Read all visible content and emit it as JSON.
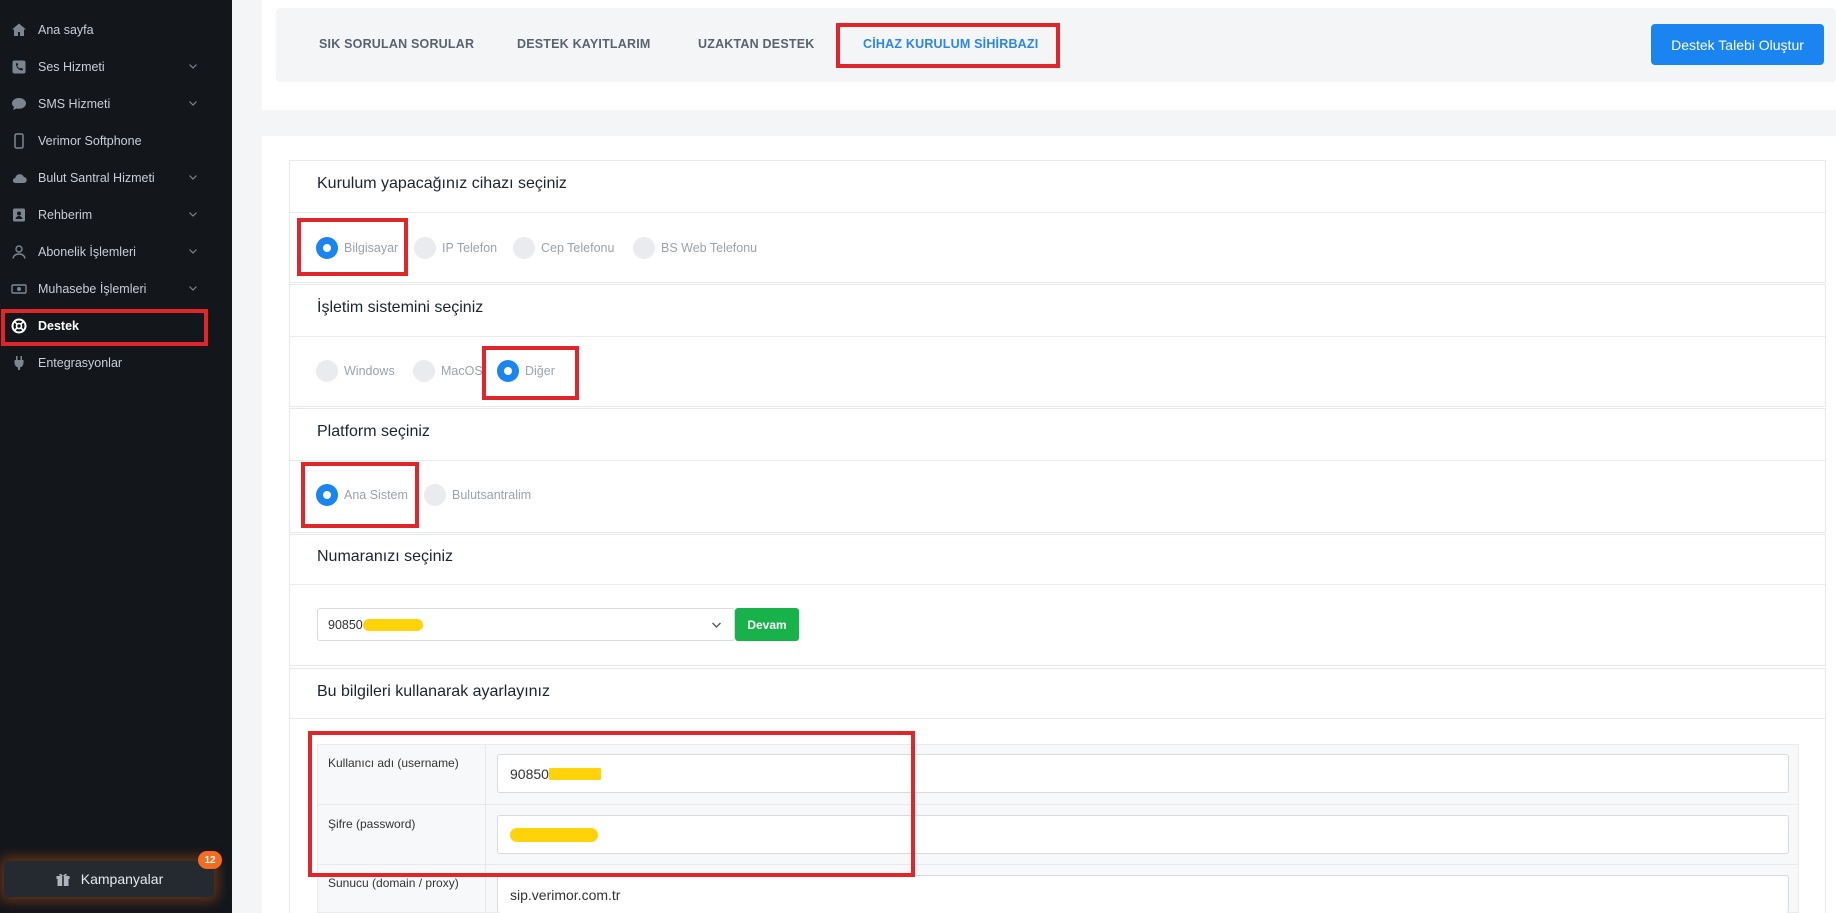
{
  "sidebar": {
    "items": [
      {
        "label": "Ana sayfa",
        "icon": "home-icon",
        "has_chevron": false
      },
      {
        "label": "Ses Hizmeti",
        "icon": "phone-icon",
        "has_chevron": true
      },
      {
        "label": "SMS Hizmeti",
        "icon": "chat-icon",
        "has_chevron": true
      },
      {
        "label": "Verimor Softphone",
        "icon": "mobile-icon",
        "has_chevron": false
      },
      {
        "label": "Bulut Santral Hizmeti",
        "icon": "cloud-icon",
        "has_chevron": true
      },
      {
        "label": "Rehberim",
        "icon": "contacts-icon",
        "has_chevron": true
      },
      {
        "label": "Abonelik İşlemleri",
        "icon": "user-icon",
        "has_chevron": true
      },
      {
        "label": "Muhasebe İşlemleri",
        "icon": "money-icon",
        "has_chevron": true
      },
      {
        "label": "Destek",
        "icon": "lifebuoy-icon",
        "has_chevron": false,
        "active": true
      },
      {
        "label": "Entegrasyonlar",
        "icon": "plug-icon",
        "has_chevron": false
      }
    ],
    "campaigns": {
      "label": "Kampanyalar",
      "badge": "12",
      "icon": "gift-icon"
    }
  },
  "tabs": [
    {
      "label": "SIK SORULAN SORULAR"
    },
    {
      "label": "DESTEK KAYITLARIM"
    },
    {
      "label": "UZAKTAN DESTEK"
    },
    {
      "label": "CİHAZ KURULUM SİHİRBAZI",
      "active": true
    }
  ],
  "cta_label": "Destek Talebi Oluştur",
  "device_section": {
    "title": "Kurulum yapacağınız cihazı seçiniz",
    "options": [
      "Bilgisayar",
      "IP Telefon",
      "Cep Telefonu",
      "BS Web Telefonu"
    ],
    "selected": "Bilgisayar"
  },
  "os_section": {
    "title": "İşletim sistemini seçiniz",
    "options": [
      "Windows",
      "MacOS",
      "Diğer"
    ],
    "selected": "Diğer"
  },
  "platform_section": {
    "title": "Platform seçiniz",
    "options": [
      "Ana Sistem",
      "Bulutsantralim"
    ],
    "selected": "Ana Sistem"
  },
  "number_section": {
    "title": "Numaranızı seçiniz",
    "selected_prefix": "90850",
    "continue_label": "Devam"
  },
  "settings_section": {
    "title": "Bu bilgileri kullanarak ayarlayınız",
    "rows": [
      {
        "label": "Kullanıcı adı (username)",
        "value_prefix": "90850",
        "redacted": true
      },
      {
        "label": "Şifre (password)",
        "value_prefix": "",
        "redacted": true
      },
      {
        "label": "Sunucu (domain / proxy)",
        "value_prefix": "sip.verimor.com.tr",
        "redacted": false
      }
    ]
  },
  "colors": {
    "accent": "#1a84f0",
    "success": "#17b34a",
    "highlight": "#e0252b",
    "sidebar_bg": "#13161b",
    "redaction": "#ffd20a",
    "badge": "#f36c21"
  }
}
